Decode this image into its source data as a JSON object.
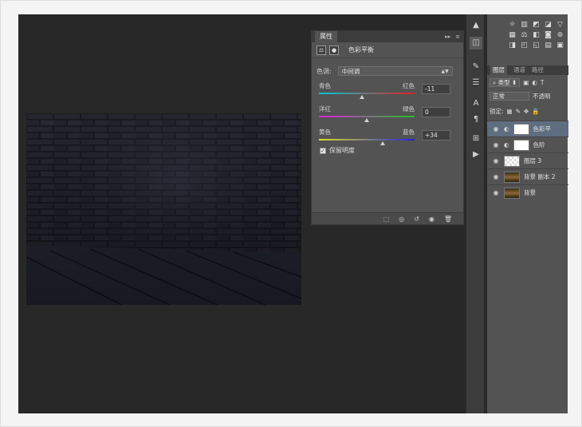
{
  "properties_panel": {
    "tab_label": "属性",
    "header_label": "色彩平衡",
    "tone": {
      "label": "色调:",
      "value": "中间调"
    },
    "sliders": [
      {
        "left": "青色",
        "right": "红色",
        "value": "-11",
        "gradient": [
          "#00c8d8",
          "#e02020"
        ],
        "position": 0.45
      },
      {
        "left": "洋红",
        "right": "绿色",
        "value": "0",
        "gradient": [
          "#e020e0",
          "#20c020"
        ],
        "position": 0.5
      },
      {
        "left": "黄色",
        "right": "蓝色",
        "value": "+34",
        "gradient": [
          "#e0e020",
          "#2020e0"
        ],
        "position": 0.67
      }
    ],
    "preserve_luminosity": {
      "label": "保留明度",
      "checked": true
    }
  },
  "layers_panel": {
    "tabs": [
      "图层",
      "通道",
      "路径"
    ],
    "filter_label": "类型",
    "blend_mode": "正常",
    "opacity_label": "不透明",
    "lock_label": "锁定:",
    "layers": [
      {
        "name": "色彩平",
        "selected": true,
        "type": "adjustment"
      },
      {
        "name": "色阶",
        "selected": false,
        "type": "adjustment"
      },
      {
        "name": "图层 3",
        "selected": false,
        "type": "transparent"
      },
      {
        "name": "背景 副本 2",
        "selected": false,
        "type": "image"
      },
      {
        "name": "背景",
        "selected": false,
        "type": "image"
      }
    ]
  },
  "colors": {
    "workspace": "#282828",
    "panel": "#535353",
    "selection": "#5f6d80"
  }
}
